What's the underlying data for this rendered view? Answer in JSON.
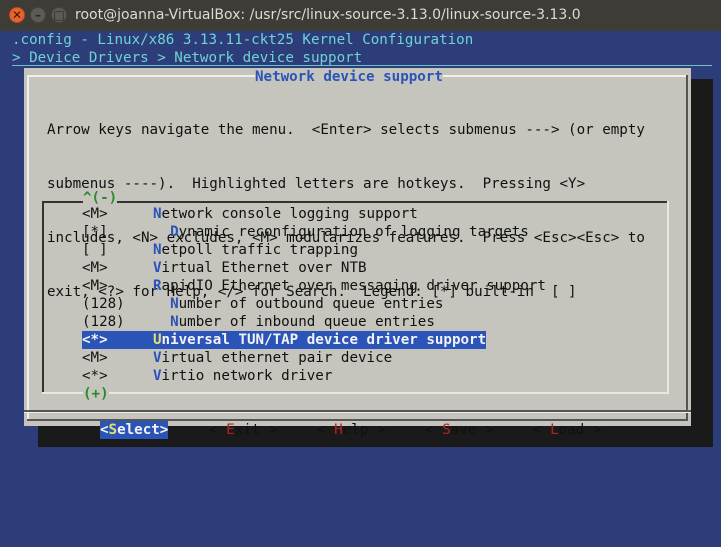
{
  "window": {
    "title": "root@joanna-VirtualBox: /usr/src/linux-source-3.13.0/linux-source-3.13.0",
    "close_glyph": "✕",
    "min_glyph": "–",
    "max_glyph": "□"
  },
  "header": {
    "config_line": ".config - Linux/x86 3.13.11-ckt25 Kernel Configuration",
    "breadcrumb": "> Device Drivers > Network device support"
  },
  "dialog": {
    "title": "Network device support",
    "help_lines": [
      "Arrow keys navigate the menu.  <Enter> selects submenus ---> (or empty",
      "submenus ----).  Highlighted letters are hotkeys.  Pressing <Y>",
      "includes, <N> excludes, <M> modularizes features.  Press <Esc><Esc> to",
      "exit, <?> for Help, </> for Search.  Legend: [*] built-in  [ ]"
    ],
    "scroll_up": "^(-)",
    "scroll_down": "(+)",
    "items": [
      {
        "mark": "<M>",
        "indent": "",
        "hot": "N",
        "rest": "etwork console logging support"
      },
      {
        "mark": "[*]",
        "indent": "  ",
        "hot": "D",
        "rest": "ynamic reconfiguration of logging targets"
      },
      {
        "mark": "[ ]",
        "indent": "",
        "hot": "N",
        "rest": "etpoll traffic trapping"
      },
      {
        "mark": "<M>",
        "indent": "",
        "hot": "V",
        "rest": "irtual Ethernet over NTB"
      },
      {
        "mark": "<M>",
        "indent": "",
        "hot": "R",
        "rest": "apidIO Ethernet over messaging driver support"
      },
      {
        "mark": "(128)",
        "indent": "  ",
        "hot": "N",
        "rest": "umber of outbound queue entries"
      },
      {
        "mark": "(128)",
        "indent": "  ",
        "hot": "N",
        "rest": "umber of inbound queue entries"
      },
      {
        "mark": "<*>",
        "indent": "",
        "hot": "U",
        "rest": "niversal TUN/TAP device driver support"
      },
      {
        "mark": "<M>",
        "indent": "",
        "hot": "V",
        "rest": "irtual ethernet pair device"
      },
      {
        "mark": "<*>",
        "indent": "",
        "hot": "V",
        "rest": "irtio network driver"
      }
    ],
    "selected_index": 7,
    "buttons": {
      "select": {
        "pre": "<",
        "hk": "S",
        "post": "elect>"
      },
      "exit": {
        "pre": "< ",
        "hk": "E",
        "post": "xit >"
      },
      "help": {
        "pre": "< ",
        "hk": "H",
        "post": "elp >"
      },
      "save": {
        "pre": "< ",
        "hk": "S",
        "post": "ave >"
      },
      "load": {
        "pre": "< ",
        "hk": "L",
        "post": "oad >"
      }
    }
  },
  "colors": {
    "terminal_bg": "#2c3d7a",
    "dialog_bg": "#c5c4bd",
    "accent": "#2b54b8",
    "header_text": "#6fd3d3",
    "hotkey": "#b22222"
  }
}
